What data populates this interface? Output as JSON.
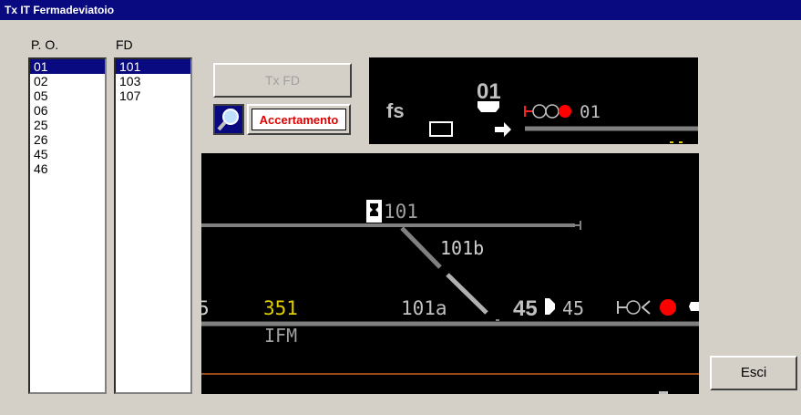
{
  "window": {
    "title": "Tx IT Fermadeviatoio"
  },
  "po_list": {
    "header": "P. O.",
    "items": [
      "01",
      "02",
      "05",
      "06",
      "25",
      "26",
      "45",
      "46"
    ],
    "selected": "01"
  },
  "fd_list": {
    "header": "FD",
    "items": [
      "101",
      "103",
      "107"
    ],
    "selected": "101"
  },
  "buttons": {
    "tx_fd": "Tx FD",
    "accertamento": "Accertamento",
    "esci": "Esci"
  },
  "top_view": {
    "fs_label": "fs",
    "po_number": "01",
    "signal_label": "01"
  },
  "main_view": {
    "switch_label": "101",
    "branch_b_label": "101b",
    "branch_a_label": "101a",
    "left_cut_label": "5",
    "yellow_label": "351",
    "ifm_label": "IFM",
    "po_45_bold": "45",
    "signal_45_label": "45"
  },
  "colors": {
    "selection": "#0a0a80",
    "track": "#808080",
    "signal_red": "#ff0000",
    "yellow_text": "#e0d000",
    "orange_line": "#c86020"
  }
}
